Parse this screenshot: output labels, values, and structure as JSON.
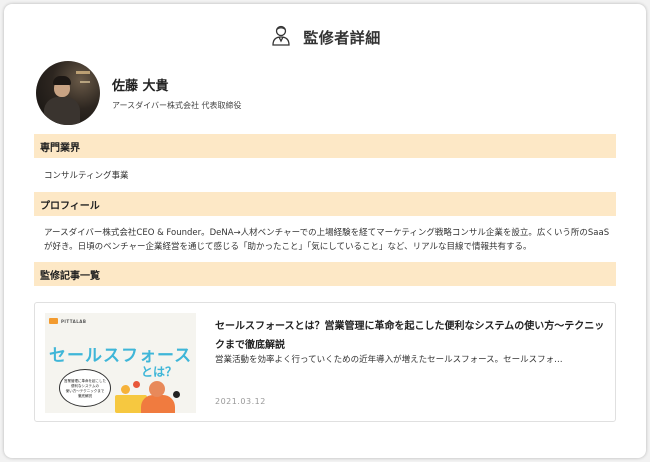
{
  "header": {
    "title": "監修者詳細",
    "icon": "supervisor-icon"
  },
  "profile": {
    "name": "佐藤 大貴",
    "role": "アースダイバー株式会社 代表取締役"
  },
  "sections": {
    "specialty_heading": "専門業界",
    "specialty_value": "コンサルティング事業",
    "profile_heading": "プロフィール",
    "profile_text": "アースダイバー株式会社CEO & Founder。DeNA→人材ベンチャーでの上場経験を経てマーケティング戦略コンサル企業を設立。広くいう所のSaaSが好き。日頃のベンチャー企業経営を通じて感じる「助かったこと」「気にしていること」など、リアルな目線で情報共有する。",
    "articles_heading": "監修記事一覧"
  },
  "articles": [
    {
      "title": "セールスフォースとは？営業管理に革命を起こした便利なシステムの使い方～テクニックまで徹底解説",
      "excerpt": "営業活動を効率よく行っていくための近年導入が増えたセールスフォース。セールスフォ…",
      "date": "2021.03.12",
      "thumbnail": {
        "brand": "PITTALAB",
        "title": "セールスフォース",
        "subtitle": "とは？",
        "bubble_lines": [
          "営業管理に革命を起こした",
          "便利なシステムの",
          "使い方～テクニックまで",
          "徹底解説"
        ]
      }
    }
  ],
  "colors": {
    "section_bar": "#fde8c6",
    "thumb_accent": "#3fb6d8",
    "date": "#999999"
  }
}
